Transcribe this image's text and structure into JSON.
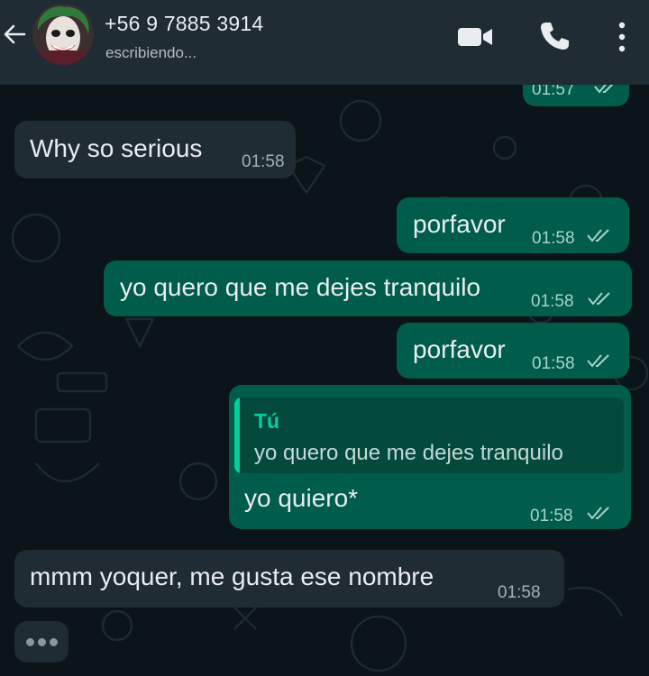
{
  "header": {
    "contact_name": "+56 9 7885 3914",
    "status": "escribiendo...",
    "icons": [
      "back-arrow-icon",
      "avatar",
      "video-call-icon",
      "phone-call-icon",
      "more-options-icon"
    ]
  },
  "messages": {
    "top_partial_time": "01:57",
    "m1": {
      "text": "Why so serious",
      "time": "01:58",
      "direction": "incoming"
    },
    "m2": {
      "text": "porfavor",
      "time": "01:58",
      "direction": "outgoing"
    },
    "m3": {
      "text": "yo quero que me dejes tranquilo",
      "time": "01:58",
      "direction": "outgoing"
    },
    "m4": {
      "text": "porfavor",
      "time": "01:58",
      "direction": "outgoing"
    },
    "m5": {
      "quote_author": "Tú",
      "quote_text": "yo quero que me dejes tranquilo",
      "text": "yo quiero*",
      "time": "01:58",
      "direction": "outgoing"
    },
    "m6": {
      "text": "mmm yoquer, me gusta ese nombre",
      "time": "01:58",
      "direction": "incoming"
    }
  },
  "colors": {
    "header_bg": "#1f2c34",
    "incoming_bubble": "#1f2c34",
    "outgoing_bubble": "#005c4b",
    "read_ticks": "#a9d3c8",
    "quote_accent": "#06cf9c"
  }
}
